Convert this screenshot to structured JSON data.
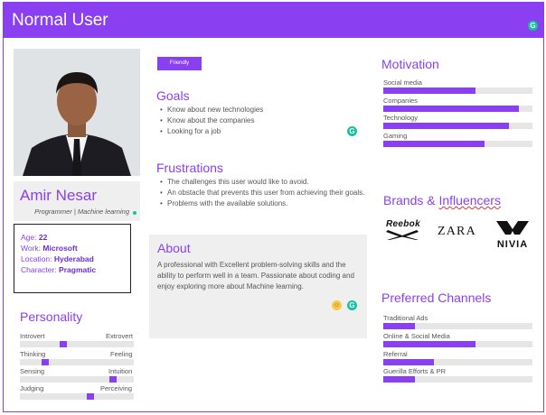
{
  "header": {
    "title": "Normal User"
  },
  "profile": {
    "name": "Amir Nesar",
    "role": "Programmer | Machine learning",
    "facts": [
      {
        "label": "Age: ",
        "value": "22"
      },
      {
        "label": "Work: ",
        "value": "Microsoft"
      },
      {
        "label": "Location: ",
        "value": "Hyderabad"
      },
      {
        "label": "Character: ",
        "value": "Pragmatic"
      }
    ]
  },
  "personality": {
    "title": "Personality",
    "scales": [
      {
        "left": "Introvert",
        "right": "Extrovert",
        "level": 0.38
      },
      {
        "left": "Thinking",
        "right": "Feeling",
        "level": 0.22
      },
      {
        "left": "Sensing",
        "right": "Intuition",
        "level": 0.82
      },
      {
        "left": "Judging",
        "right": "Perceiving",
        "level": 0.62
      }
    ]
  },
  "tag": "Friendly",
  "goals": {
    "title": "Goals",
    "items": [
      "Know about new technologies",
      "Know about the companies",
      "Looking for a job"
    ]
  },
  "frustrations": {
    "title": "Frustrations",
    "items": [
      "The challenges this user would like to avoid.",
      "An obstacle that prevents this user from achieving their goals.",
      "Problems with the available solutions."
    ]
  },
  "about": {
    "title": "About",
    "text": "A professional with Excellent problem-solving skills and the ability to perform well in a team. Passionate about coding and enjoy exploring more about Machine learning."
  },
  "motivation": {
    "title": "Motivation",
    "items": [
      {
        "label": "Social media",
        "level": 0.62
      },
      {
        "label": "Companies",
        "level": 0.91
      },
      {
        "label": "Technology",
        "level": 0.84
      },
      {
        "label": "Gaming",
        "level": 0.68
      }
    ]
  },
  "brands": {
    "title_main": "Brands & ",
    "title_underlined": "Influencers",
    "logos": [
      "Reebok",
      "ZARA",
      "NIVIA"
    ]
  },
  "channels": {
    "title": "Preferred Channels",
    "items": [
      {
        "label": "Traditional Ads",
        "level": 0.21
      },
      {
        "label": "Online & Social Media",
        "level": 0.62
      },
      {
        "label": "Referral",
        "level": 0.34
      },
      {
        "label": "Guerilla Efforts & PR",
        "level": 0.21
      }
    ]
  },
  "colors": {
    "accent": "#8a3ff0",
    "panel": "#efefef",
    "track": "#e6e6e6",
    "grammarly": "#15c39a"
  }
}
